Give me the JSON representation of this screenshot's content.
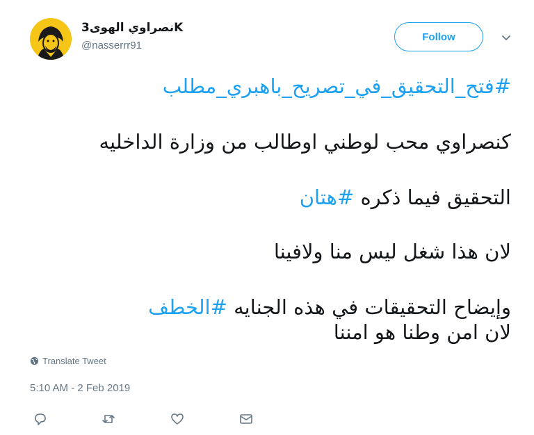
{
  "tweet": {
    "author": {
      "display_name": "3نصراوي الهوىK",
      "username": "@nasserrr91",
      "avatar_icon": "avatar-image"
    },
    "follow_label": "Follow",
    "hashtag_line": "#فتح_التحقيق_في_تصريح_باهبري_مطلب",
    "line1": "كنصراوي محب لوطني اوطالب من وزارة الداخليه",
    "line2_text": "التحقيق فيما ذكره ",
    "line2_hashtag": "#هتان",
    "line3": "لان هذا شغل ليس منا ولافينا",
    "line4_text": "وإيضاح التحقيقات في هذه الجنايه ",
    "line4_hashtag": "#الخطف",
    "line5": "لان امن وطنا هو امننا",
    "translate_label": "Translate Tweet",
    "timestamp": "5:10 AM - 2 Feb 2019"
  },
  "actions": {
    "reply_icon": "reply-icon",
    "retweet_icon": "retweet-icon",
    "like_icon": "heart-icon",
    "message_icon": "envelope-icon"
  },
  "colors": {
    "accent": "#1da1f2",
    "secondary_text": "#657786",
    "primary_text": "#14171a"
  }
}
